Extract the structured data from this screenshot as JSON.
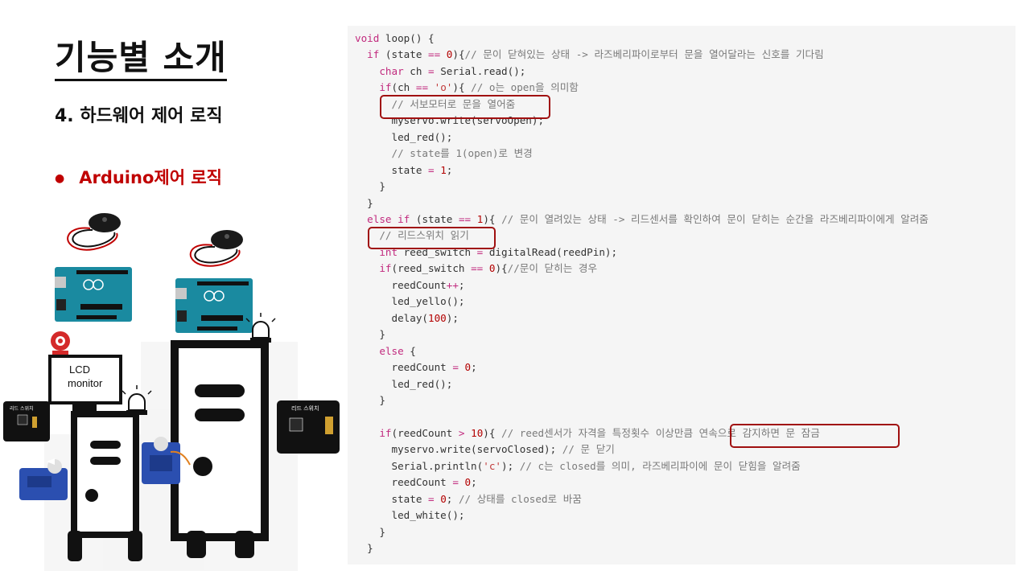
{
  "slide": {
    "title": "기능별 소개",
    "subtitle": "4. 하드웨어 제어 로직",
    "bullet": "Arduino제어 로직"
  },
  "illustration": {
    "lcd_label_line1": "LCD",
    "lcd_label_line2": "monitor",
    "reed_module_label": "리드 스위치"
  },
  "code_lines": [
    "void loop() {",
    "  if (state == 0){// 문이 닫혀있는 상태 -> 라즈베리파이로부터 문을 열어달라는 신호를 기다림",
    "    char ch = Serial.read();",
    "    if(ch == 'o'){ // o는 open을 의미함",
    "      // 서보모터로 문을 열어줌",
    "      myservo.write(servoOpen);",
    "      led_red();",
    "      // state를 1(open)로 변경",
    "      state = 1;",
    "    }",
    "  }",
    "  else if (state == 1){ // 문이 열려있는 상태 -> 리드센서를 확인하여 문이 닫히는 순간을 라즈베리파이에게 알려줌",
    "    // 리드스위치 읽기",
    "    int reed_switch = digitalRead(reedPin);",
    "    if(reed_switch == 0){//문이 닫히는 경우",
    "      reedCount++;",
    "      led_yello();",
    "      delay(100);",
    "    }",
    "    else {",
    "      reedCount = 0;",
    "      led_red();",
    "    }",
    "",
    "    if(reedCount > 10){ // reed센서가 자격을 특정횟수 이상만큼 연속으로 감지하면 문 잠금",
    "      myservo.write(servoClosed); // 문 닫기",
    "      Serial.println('c'); // c는 closed를 의미, 라즈베리파이에 문이 닫힘을 알려줌",
    "      reedCount = 0;",
    "      state = 0; // 상태를 closed로 바꿈",
    "      led_white();",
    "    }",
    "  }"
  ],
  "colors": {
    "highlight_box": "#a01010",
    "bullet": "#c00000",
    "code_bg": "#f5f5f5"
  }
}
